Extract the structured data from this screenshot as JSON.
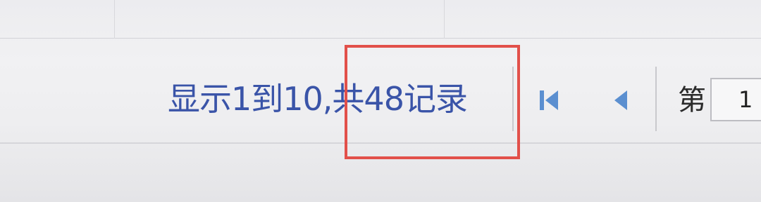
{
  "pager": {
    "record_info": "显示1到10,共48记录",
    "page_label": "第",
    "page_input_value": "1"
  },
  "icons": {
    "first_page": "first-page-icon",
    "prev_page": "previous-page-icon"
  },
  "colors": {
    "info_text": "#3a54a8",
    "nav_icon": "#5b8fd0",
    "highlight": "#e2504a"
  }
}
